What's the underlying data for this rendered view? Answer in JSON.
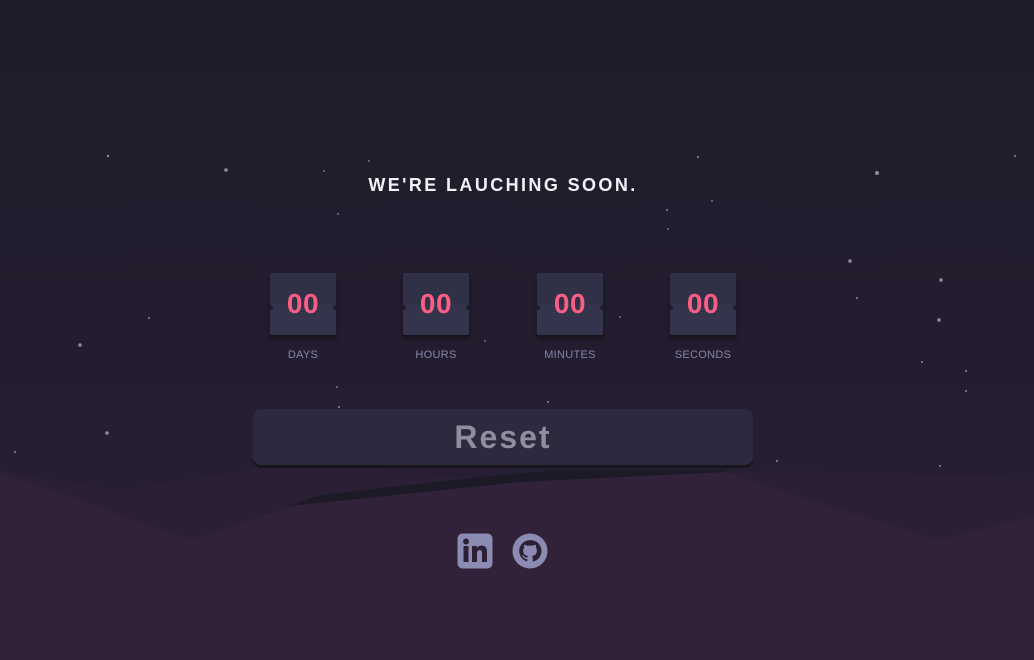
{
  "page": {
    "heading": "WE'RE LAUCHING SOON."
  },
  "countdown": {
    "days": {
      "value": "00",
      "label": "DAYS"
    },
    "hours": {
      "value": "00",
      "label": "HOURS"
    },
    "minutes": {
      "value": "00",
      "label": "MINUTES"
    },
    "seconds": {
      "value": "00",
      "label": "SECONDS"
    }
  },
  "controls": {
    "reset_label": "Reset"
  },
  "social": {
    "icons": [
      "linkedin-icon",
      "github-icon"
    ]
  },
  "colors": {
    "accent": "#fb5e84",
    "card": "#34344c",
    "label": "#8486a9",
    "icon": "#8c8bb4",
    "hill": "#31223a"
  }
}
